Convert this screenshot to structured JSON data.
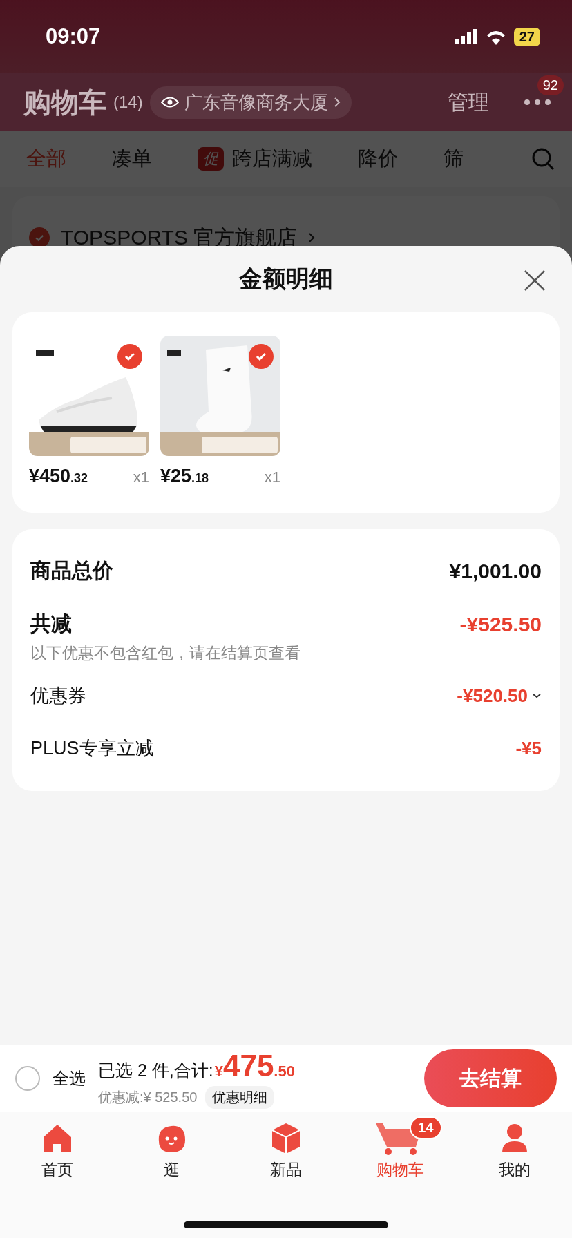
{
  "status_bar": {
    "time": "09:07",
    "battery": "27"
  },
  "header": {
    "title": "购物车",
    "count": "(14)",
    "location": "广东音像商务大厦",
    "manage": "管理",
    "more_badge": "92"
  },
  "filter_tabs": [
    {
      "label": "全部",
      "selected": true
    },
    {
      "label": "凑单",
      "selected": false
    },
    {
      "label": "跨店满减",
      "badge": "促",
      "selected": false
    },
    {
      "label": "降价",
      "selected": false
    },
    {
      "label": "筛",
      "selected": false
    }
  ],
  "store": {
    "name": "TOPSPORTS 官方旗舰店",
    "checked": true
  },
  "sheet": {
    "title": "金额明细",
    "items": [
      {
        "kind": "shoe",
        "price": "¥450",
        "cents": ".32",
        "qty": "x1",
        "checked": true
      },
      {
        "kind": "sock",
        "price": "¥25",
        "cents": ".18",
        "qty": "x1",
        "checked": true
      }
    ],
    "summary": [
      {
        "kind": "total",
        "label": "商品总价",
        "value": "¥1,001.00"
      },
      {
        "kind": "discount",
        "label": "共减",
        "value": "-¥525.50",
        "note": "以下优惠不包含红包，请在结算页查看"
      },
      {
        "kind": "line",
        "label": "优惠券",
        "value": "-¥520.50",
        "expandable": true
      },
      {
        "kind": "line",
        "label": "PLUS专享立减",
        "value": "-¥5",
        "expandable": false
      }
    ]
  },
  "checkout": {
    "select_all": {
      "label": "全选",
      "checked": false
    },
    "selected_text": "已选 2 件,合计:",
    "currency": "¥",
    "amount": "475",
    "cents": ".50",
    "saving": "优惠减:¥ 525.50",
    "details": "优惠明细",
    "button": "去结算"
  },
  "nav": [
    {
      "label": "首页",
      "kind": "home",
      "selected": false
    },
    {
      "label": "逛",
      "kind": "blob",
      "selected": false
    },
    {
      "label": "新品",
      "kind": "cube",
      "selected": false
    },
    {
      "label": "购物车",
      "kind": "cart",
      "selected": true,
      "badge": "14"
    },
    {
      "label": "我的",
      "kind": "person",
      "selected": false
    }
  ]
}
